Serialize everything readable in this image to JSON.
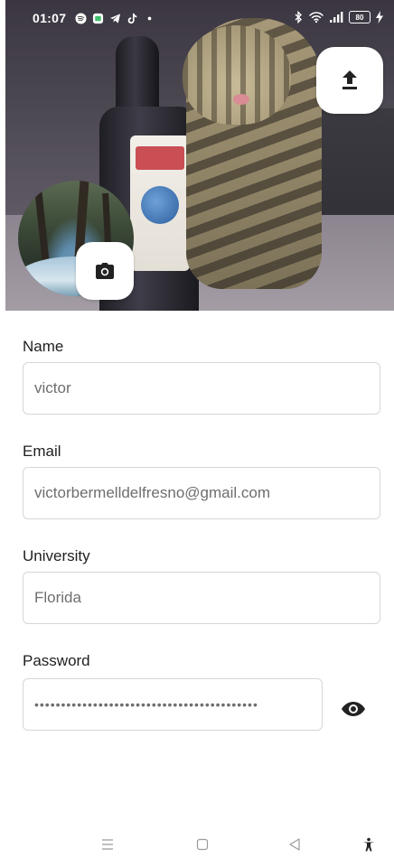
{
  "status_bar": {
    "time": "01:07",
    "battery": "80",
    "left_icons": [
      "spotify-icon",
      "messages-icon",
      "telegram-icon",
      "tiktok-icon",
      "dot-icon"
    ],
    "right_icons": [
      "bluetooth-icon",
      "wifi-icon",
      "signal-icon",
      "battery-icon",
      "charging-icon"
    ]
  },
  "header": {
    "upload_icon": "upload-icon",
    "camera_icon": "camera-icon"
  },
  "form": {
    "name": {
      "label": "Name",
      "value": "victor"
    },
    "email": {
      "label": "Email",
      "value": "victorbermelldelfresno@gmail.com"
    },
    "university": {
      "label": "University",
      "value": "Florida"
    },
    "password": {
      "label": "Password",
      "value": "••••••••••••••••••••••••••••••••••••••••••",
      "toggle_icon": "eye-icon"
    }
  },
  "nav_bar": {
    "items": [
      "menu-icon",
      "home-icon",
      "back-icon",
      "accessibility-icon"
    ]
  },
  "colors": {
    "accent": "#222222",
    "field_border": "#d6d6d6",
    "field_text": "#6e6e6e"
  }
}
